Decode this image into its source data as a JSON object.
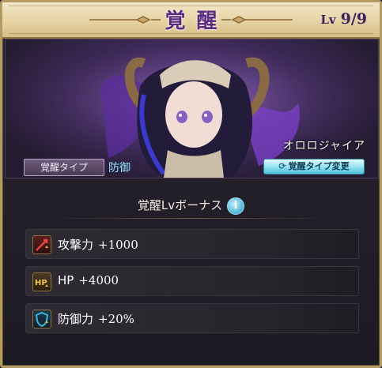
{
  "header": {
    "title": "覚醒",
    "level_tag": "Lv",
    "level_value": "9/9"
  },
  "character": {
    "name": "オロロジャイア"
  },
  "awakening_type": {
    "label": "覚醒タイプ",
    "value": "防御",
    "change_button": "覚醒タイプ変更",
    "change_icon": "refresh-icon"
  },
  "bonus": {
    "title": "覚醒Lvボーナス",
    "info_icon": "info-icon",
    "items": [
      {
        "label": "攻撃力",
        "value": "+1000",
        "icon": "attack-up-icon",
        "icon_color": "#c0392b"
      },
      {
        "label": "HP",
        "value": "+4000",
        "icon": "hp-up-icon",
        "icon_color": "#e0a030",
        "icon_text": "HP"
      },
      {
        "label": "防御力",
        "value": "+20%",
        "icon": "defense-up-icon",
        "icon_color": "#2ea0c8"
      }
    ]
  },
  "colors": {
    "title_purple": "#5b2b86",
    "accent_cyan": "#8fe3ff",
    "frame_gold": "#b49a63"
  }
}
